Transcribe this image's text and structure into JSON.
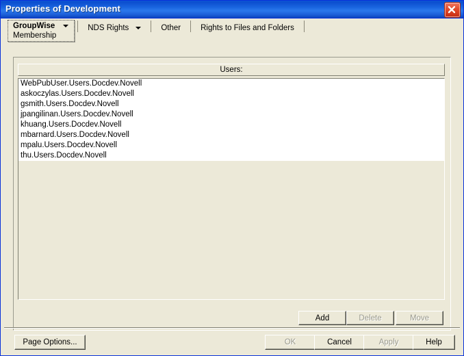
{
  "window": {
    "title": "Properties of Development",
    "close_icon": "close-icon",
    "accent_color": "#0831d9",
    "titlebar_color": "#1a66e0",
    "close_button_color": "#c62c11",
    "face_color": "#ece9d8"
  },
  "tabs": [
    {
      "label": "GroupWise",
      "sublabel": "Membership",
      "has_dropdown": true,
      "selected": true
    },
    {
      "label": "NDS Rights",
      "sublabel": "",
      "has_dropdown": true,
      "selected": false
    },
    {
      "label": "Other",
      "sublabel": "",
      "has_dropdown": false,
      "selected": false
    },
    {
      "label": "Rights to Files and Folders",
      "sublabel": "",
      "has_dropdown": false,
      "selected": false
    }
  ],
  "list": {
    "header": "Users:",
    "rows": [
      "WebPubUser.Users.Docdev.Novell",
      "askoczylas.Users.Docdev.Novell",
      "gsmith.Users.Docdev.Novell",
      "jpangilinan.Users.Docdev.Novell",
      "khuang.Users.Docdev.Novell",
      "mbarnard.Users.Docdev.Novell",
      "mpalu.Users.Docdev.Novell",
      "thu.Users.Docdev.Novell"
    ]
  },
  "list_buttons": {
    "add": "Add",
    "delete": "Delete",
    "move": "Move"
  },
  "dialog_buttons": {
    "page_options": "Page Options...",
    "ok": "OK",
    "cancel": "Cancel",
    "apply": "Apply",
    "help": "Help"
  }
}
